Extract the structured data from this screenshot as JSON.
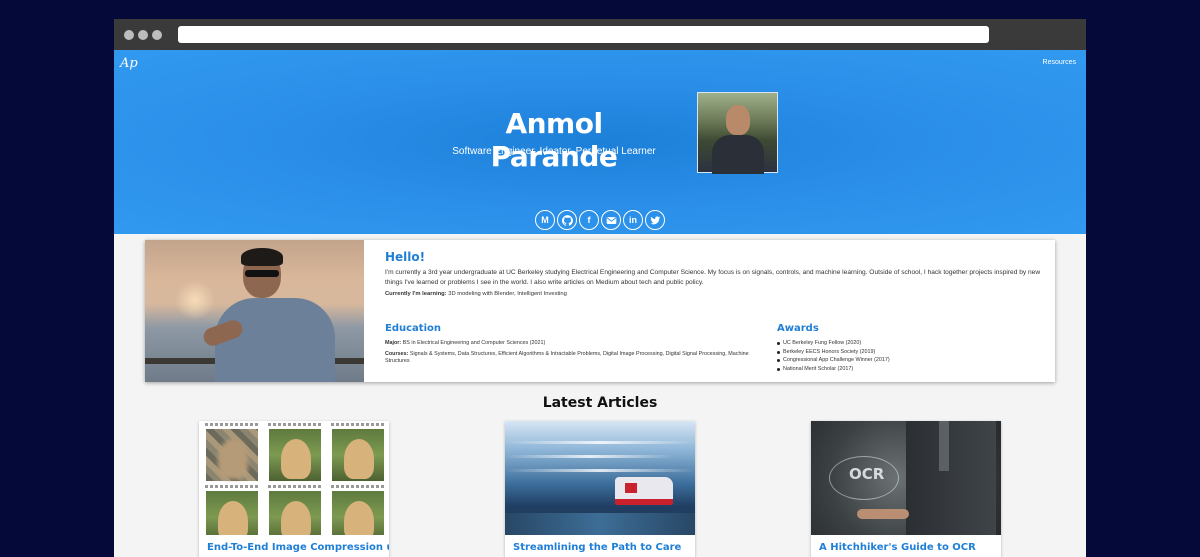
{
  "browser": {
    "url": ""
  },
  "nav": {
    "logo": "Ap",
    "resources": "Resources"
  },
  "hero": {
    "name": "Anmol Parande",
    "subtitle": "Software Engineer, Ideator, Perpetual Learner",
    "social": [
      {
        "name": "medium-icon",
        "glyph": "M"
      },
      {
        "name": "github-icon"
      },
      {
        "name": "facebook-icon",
        "glyph": "f"
      },
      {
        "name": "email-icon"
      },
      {
        "name": "linkedin-icon",
        "glyph": "in"
      },
      {
        "name": "twitter-icon"
      }
    ]
  },
  "about": {
    "heading": "Hello!",
    "intro": "I'm currently a 3rd year undergraduate at UC Berkeley studying Electrical Engineering and Computer Science. My focus is on signals, controls, and machine learning. Outside of school, I hack together projects inspired by new things I've learned or problems I see in the world. I also write articles on Medium about tech and public policy.",
    "learning_label": "Currently I'm learning:",
    "learning_value": " 3D modeling with Blender, Intelligent Investing",
    "education": {
      "heading": "Education",
      "major_label": "Major:",
      "major_value": " BS in Electrical Engineering and Computer Sciences (2021)",
      "courses_label": "Courses:",
      "courses_value": " Signals & Systems, Data Structures, Efficient Algorithms & Intractable Problems, Digital Image Processing, Digital Signal Processing, Machine Structures"
    },
    "awards": {
      "heading": "Awards",
      "items": [
        "UC Berkeley Fung Fellow (2020)",
        "Berkeley EECS Honors Society (2019)",
        "Congressional App Challenge Winner (2017)",
        "National Merit Scholar (2017)"
      ]
    }
  },
  "articles": {
    "heading": "Latest Articles",
    "items": [
      {
        "title": "End-To-End Image Compression using"
      },
      {
        "title": "Streamlining the Path to Care"
      },
      {
        "title": "A Hitchhiker's Guide to OCR",
        "image_text": "OCR"
      }
    ]
  },
  "colors": {
    "hero_blue": "#2a8ee8",
    "accent": "#1f7fd6",
    "background": "#04093a"
  }
}
